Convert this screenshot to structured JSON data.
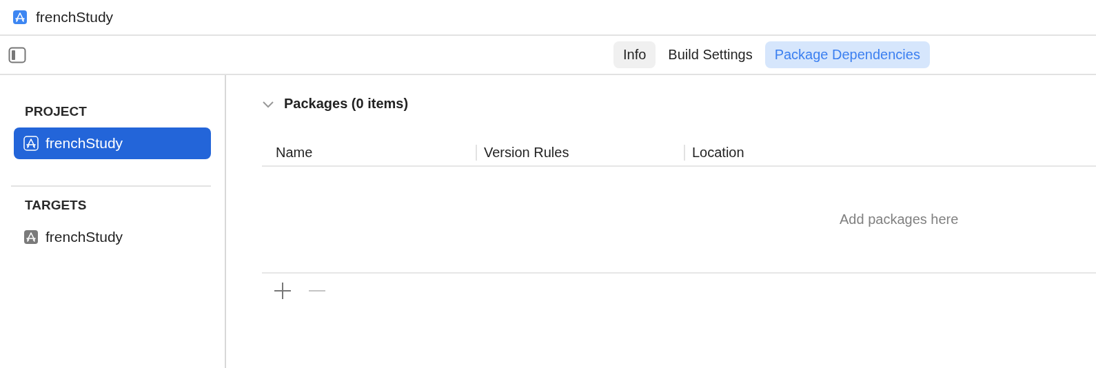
{
  "window": {
    "title": "frenchStudy"
  },
  "tabs": [
    {
      "label": "Info",
      "selected": false,
      "hovered": true
    },
    {
      "label": "Build Settings",
      "selected": false,
      "hovered": false
    },
    {
      "label": "Package Dependencies",
      "selected": true,
      "hovered": false
    }
  ],
  "sidebar": {
    "sections": [
      {
        "heading": "PROJECT",
        "items": [
          {
            "label": "frenchStudy",
            "kind": "project",
            "selected": true
          }
        ]
      },
      {
        "heading": "TARGETS",
        "items": [
          {
            "label": "frenchStudy",
            "kind": "target",
            "selected": false
          }
        ]
      }
    ]
  },
  "packages": {
    "title": "Packages (0 items)",
    "expanded": true,
    "columns": [
      "Name",
      "Version Rules",
      "Location"
    ],
    "empty_text": "Add packages here",
    "buttons": [
      {
        "kind": "add",
        "disabled": false
      },
      {
        "kind": "remove",
        "disabled": true
      }
    ]
  }
}
